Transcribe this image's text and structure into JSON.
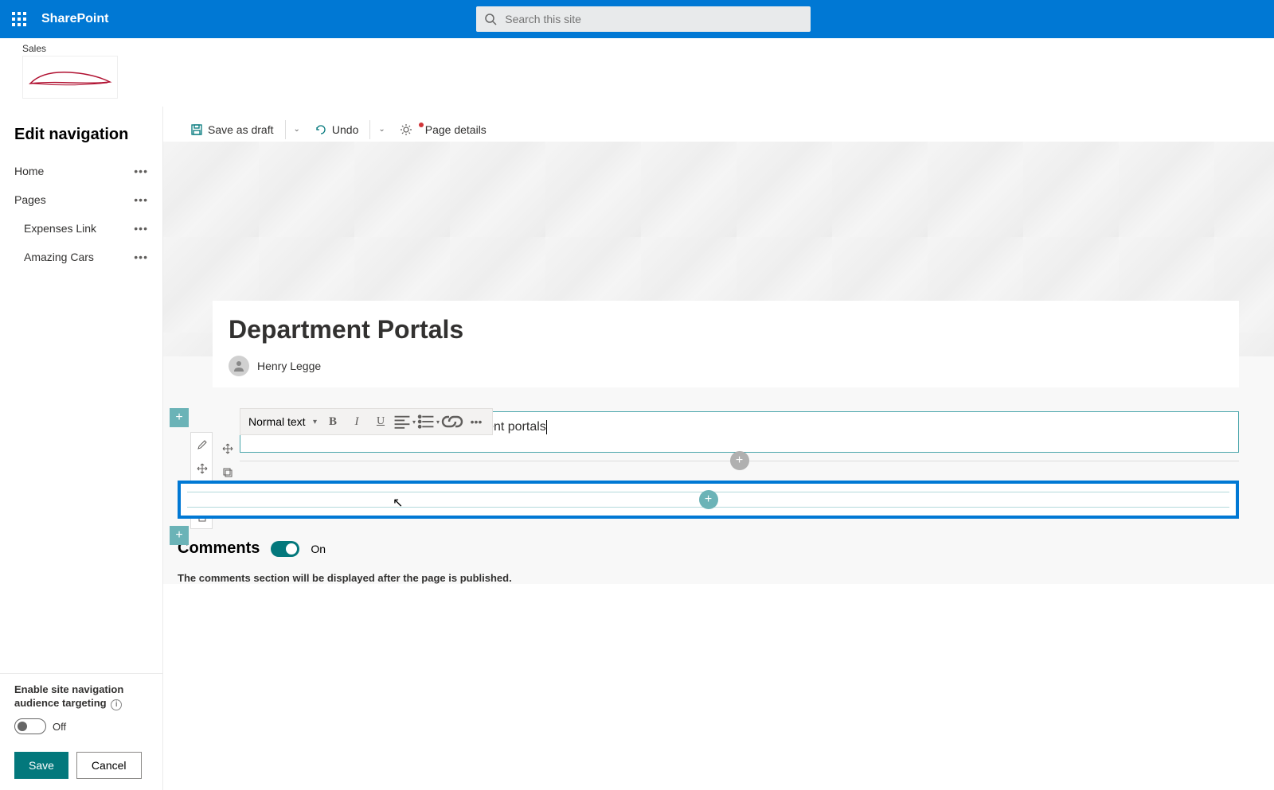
{
  "suite": {
    "app_name": "SharePoint",
    "search_placeholder": "Search this site"
  },
  "site": {
    "label": "Sales"
  },
  "left_pane": {
    "title": "Edit navigation",
    "items": [
      {
        "label": "Home",
        "sub": false
      },
      {
        "label": "Pages",
        "sub": false
      },
      {
        "label": "Expenses Link",
        "sub": true
      },
      {
        "label": "Amazing Cars",
        "sub": true
      }
    ],
    "audience_label_line1": "Enable site navigation",
    "audience_label_line2": "audience targeting",
    "audience_toggle_state": "Off",
    "save_label": "Save",
    "cancel_label": "Cancel"
  },
  "cmd": {
    "save_draft": "Save as draft",
    "undo": "Undo",
    "page_details": "Page details"
  },
  "page": {
    "title": "Department Portals",
    "author": "Henry Legge"
  },
  "rte": {
    "style": "Normal text",
    "text": "Use this page to navigate to your department portals"
  },
  "comments": {
    "title": "Comments",
    "state": "On",
    "note": "The comments section will be displayed after the page is published."
  }
}
